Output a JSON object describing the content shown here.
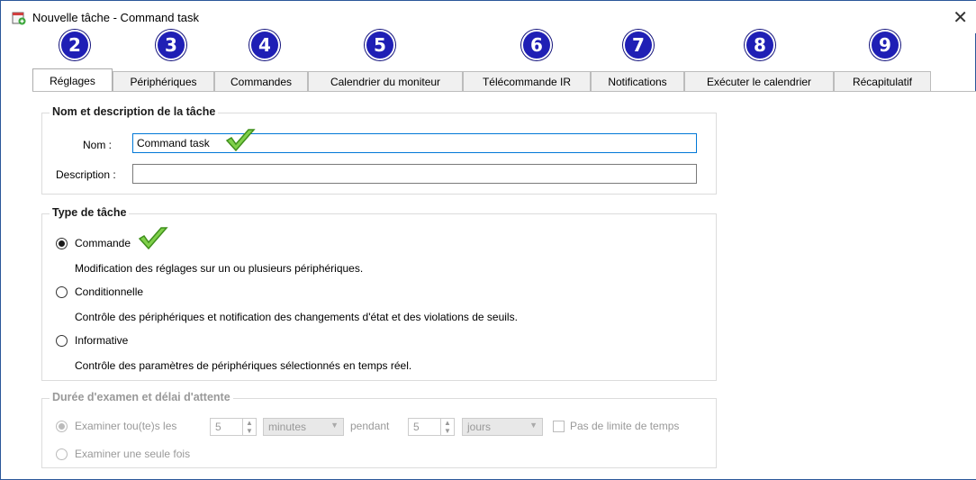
{
  "window": {
    "title": "Nouvelle tâche - Command task",
    "close_glyph": "✕"
  },
  "badges": [
    "2",
    "3",
    "4",
    "5",
    "6",
    "7",
    "8",
    "9"
  ],
  "tabs": [
    {
      "label": "Réglages"
    },
    {
      "label": "Périphériques"
    },
    {
      "label": "Commandes"
    },
    {
      "label": "Calendrier du moniteur"
    },
    {
      "label": "Télécommande IR"
    },
    {
      "label": "Notifications"
    },
    {
      "label": "Exécuter le calendrier"
    },
    {
      "label": "Récapitulatif"
    }
  ],
  "name_group": {
    "title": "Nom et description de la tâche",
    "name_label": "Nom :",
    "name_value": "Command task",
    "desc_label": "Description :",
    "desc_value": ""
  },
  "type_group": {
    "title": "Type de tâche",
    "options": [
      {
        "label": "Commande",
        "description": "Modification des réglages sur un ou plusieurs périphériques.",
        "checked": true
      },
      {
        "label": "Conditionnelle",
        "description": "Contrôle des périphériques et notification des changements d'état et des violations de seuils.",
        "checked": false
      },
      {
        "label": "Informative",
        "description": "Contrôle des paramètres de périphériques sélectionnés en temps réel.",
        "checked": false
      }
    ]
  },
  "duration_group": {
    "title": "Durée d'examen et délai d'attente",
    "examine_every_label": "Examiner tou(te)s les",
    "interval_value": "5",
    "interval_unit": "minutes",
    "during_label": "pendant",
    "duration_value": "5",
    "duration_unit": "jours",
    "no_limit_label": "Pas de limite de temps",
    "examine_once_label": "Examiner une seule fois"
  },
  "colors": {
    "badge": "#1f1fb5",
    "focus_border": "#0078d7",
    "check_green": "#5cb82e"
  }
}
